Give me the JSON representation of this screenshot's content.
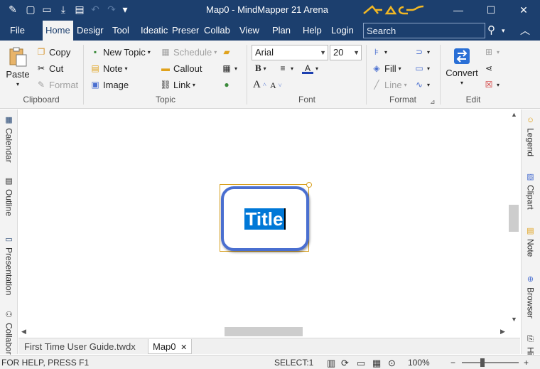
{
  "window": {
    "title": "Map0 - MindMapper 21 Arena",
    "brand": "MindMapper",
    "controls": {
      "minimize": "—",
      "maximize": "☐",
      "close": "✕"
    }
  },
  "quick_access": [
    {
      "name": "clip-icon",
      "glyph": "✎"
    },
    {
      "name": "new-icon",
      "glyph": "▢"
    },
    {
      "name": "open-icon",
      "glyph": "▭"
    },
    {
      "name": "save-icon",
      "glyph": "⤓"
    },
    {
      "name": "print-icon",
      "glyph": "▤"
    },
    {
      "name": "undo-icon",
      "glyph": "↶"
    },
    {
      "name": "redo-icon",
      "glyph": "↷"
    },
    {
      "name": "customize-icon",
      "glyph": "▾"
    }
  ],
  "menu": {
    "tabs": [
      "File",
      "Home",
      "Desigr",
      "Tool",
      "Ideatic",
      "Preser",
      "Collab",
      "View",
      "Plan",
      "Help",
      "Login"
    ],
    "active": "Home",
    "search_placeholder": "Search",
    "search_icon": "⚲",
    "collapse_icon": "︿"
  },
  "ribbon": {
    "clipboard": {
      "label": "Clipboard",
      "paste": "Paste",
      "copy": "Copy",
      "cut": "Cut",
      "format": "Format"
    },
    "topic": {
      "label": "Topic",
      "new_topic": "New Topic",
      "note": "Note",
      "image": "Image",
      "schedule": "Schedule",
      "callout": "Callout",
      "link": "Link"
    },
    "font": {
      "label": "Font",
      "family": "Arial",
      "size": "20",
      "bold": "B",
      "grow": "A",
      "shrink": "A"
    },
    "format": {
      "label": "Format",
      "fill": "Fill",
      "line": "Line"
    },
    "edit": {
      "label": "Edit",
      "convert": "Convert"
    }
  },
  "left_panel": [
    "Calendar",
    "Outline",
    "Presentation",
    "Collabor"
  ],
  "right_panel": [
    "Legend",
    "Clipart",
    "Note",
    "Browser",
    "Hi"
  ],
  "canvas": {
    "topic_text": "Title"
  },
  "doc_tabs": [
    {
      "label": "First Time User Guide.twdx",
      "active": false
    },
    {
      "label": "Map0",
      "active": true,
      "close": "✕"
    }
  ],
  "status": {
    "help": "FOR HELP, PRESS F1",
    "select": "SELECT:1",
    "zoom": "100%",
    "zoom_out": "−",
    "zoom_in": "+"
  },
  "colors": {
    "titlebar": "#1c3f6e",
    "accent": "#4a6fd0",
    "selection": "#0078d7",
    "handle": "#d8a020"
  }
}
